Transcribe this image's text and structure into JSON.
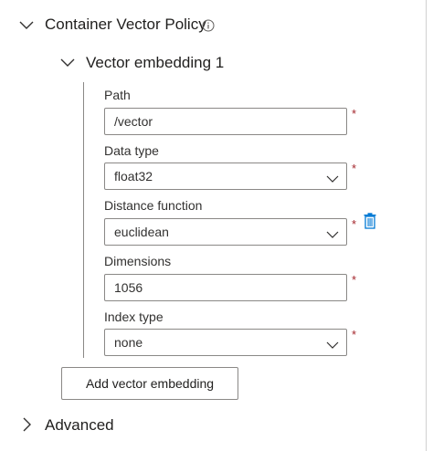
{
  "policy": {
    "title": "Container Vector Policy",
    "info_icon": "info-icon"
  },
  "embedding": {
    "title": "Vector embedding 1",
    "fields": {
      "path": {
        "label": "Path",
        "value": "/vector",
        "required": "*"
      },
      "data_type": {
        "label": "Data type",
        "value": "float32",
        "required": "*"
      },
      "distance": {
        "label": "Distance function",
        "value": "euclidean",
        "required": "*"
      },
      "dimensions": {
        "label": "Dimensions",
        "value": "1056",
        "required": "*"
      },
      "index_type": {
        "label": "Index type",
        "value": "none",
        "required": "*"
      }
    },
    "delete_icon": "trash-icon"
  },
  "add_button": {
    "label": "Add vector embedding"
  },
  "advanced": {
    "title": "Advanced"
  },
  "colors": {
    "accent": "#0078d4",
    "required": "#a4262c",
    "border": "#8a8886"
  }
}
